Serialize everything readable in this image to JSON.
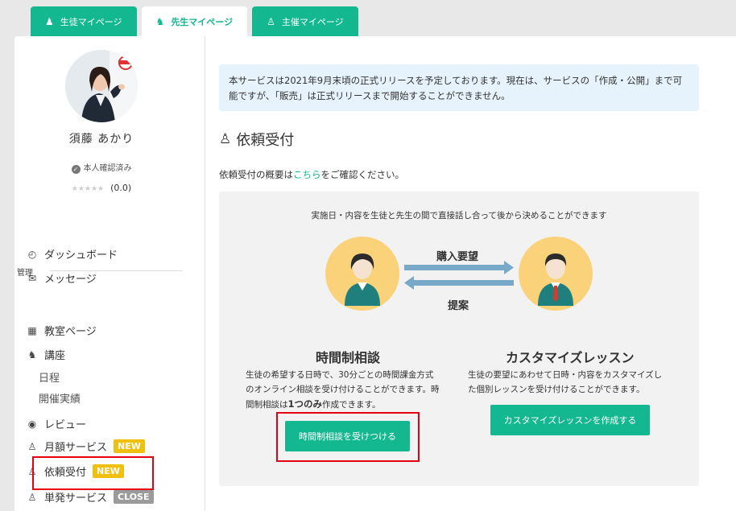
{
  "tabs": [
    {
      "label": "生徒マイページ",
      "icon": "student-icon"
    },
    {
      "label": "先生マイページ",
      "icon": "teacher-icon"
    },
    {
      "label": "主催マイページ",
      "icon": "organizer-icon"
    }
  ],
  "profile": {
    "name": "須藤 あかり",
    "verified": "本人確認済み",
    "stars": "★★★★★",
    "rating": "(0.0)"
  },
  "menu": {
    "dashboard": "ダッシュボード",
    "messages": "メッセージ",
    "section": "管理",
    "classroom": "教室ページ",
    "course": "講座",
    "schedule": "日程",
    "results": "開催実績",
    "reviews": "レビュー",
    "monthly": "月額サービス",
    "requests": "依頼受付",
    "single": "単発サービス",
    "badge_new": "NEW",
    "badge_close": "CLOSE"
  },
  "notice": "本サービスは2021年9月末頃の正式リリースを予定しております。現在は、サービスの「作成・公開」まで可能ですが、「販売」は正式リリースまで開始することができません。",
  "heading": "依頼受付",
  "intro": {
    "before": "依頼受付の概要は",
    "link": "こちら",
    "after": "をご確認ください。"
  },
  "box": {
    "title": "実施日・内容を生徒と先生の間で直接話し合って後から決めることができます",
    "arrow_top": "購入要望",
    "arrow_bottom": "提案"
  },
  "consult": {
    "title": "時間制相談",
    "desc1": "生徒の希望する日時で、30分ごとの時間課金方式",
    "desc2": "のオンライン相談を受け付けることができます。時",
    "desc3_pre": "間制相談は",
    "desc3_bold": "1つのみ",
    "desc3_post": "作成できます。",
    "button": "時間制相談を受けつける"
  },
  "custom": {
    "title": "カスタマイズレッスン",
    "desc1": "生徒の要望にあわせて日時・内容をカスタマイズし",
    "desc2": "た個別レッスンを受け付けることができます。",
    "button": "カスタマイズレッスンを作成する"
  },
  "colors": {
    "accent": "#14b890",
    "badge_new": "#f0c010",
    "badge_close": "#9b9b9b",
    "highlight": "#e60012",
    "notice_bg": "#e6f3fc"
  }
}
